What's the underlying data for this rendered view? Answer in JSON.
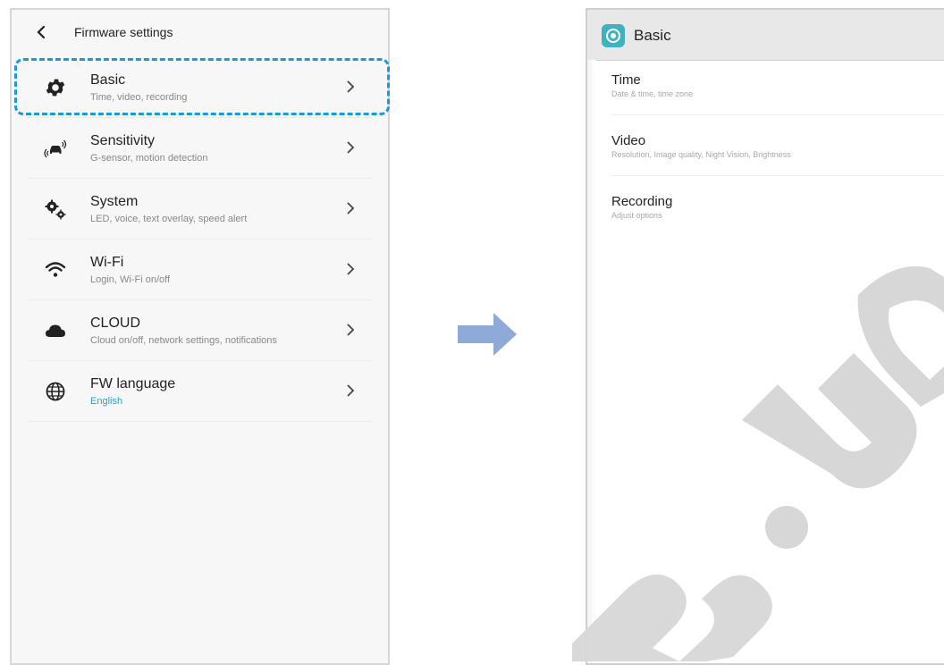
{
  "left_screen": {
    "title": "Firmware settings",
    "items": [
      {
        "label": "Basic",
        "sub": "Time, video, recording",
        "icon": "gear-icon"
      },
      {
        "label": "Sensitivity",
        "sub": "G-sensor, motion detection",
        "icon": "car-vibration-icon"
      },
      {
        "label": "System",
        "sub": "LED, voice, text overlay, speed alert",
        "icon": "gears-icon"
      },
      {
        "label": "Wi-Fi",
        "sub": "Login, Wi-Fi on/off",
        "icon": "wifi-icon"
      },
      {
        "label": "CLOUD",
        "sub": "Cloud on/off, network settings, notifications",
        "icon": "cloud-icon"
      },
      {
        "label": "FW language",
        "sub": "English",
        "icon": "globe-icon"
      }
    ]
  },
  "right_screen": {
    "title": "Basic",
    "items": [
      {
        "label": "Time",
        "sub": "Date & time, time zone"
      },
      {
        "label": "Video",
        "sub": "Resolution, Image quality, Night Vision, Brightness"
      },
      {
        "label": "Recording",
        "sub": "Adjust options"
      }
    ]
  },
  "colors": {
    "highlight": "#1a9ad6",
    "arrow": "#8fa9d8",
    "accent_text": "#2aa2c8",
    "app_icon": "#3fb1c2",
    "watermark": "#d7d7d7"
  }
}
